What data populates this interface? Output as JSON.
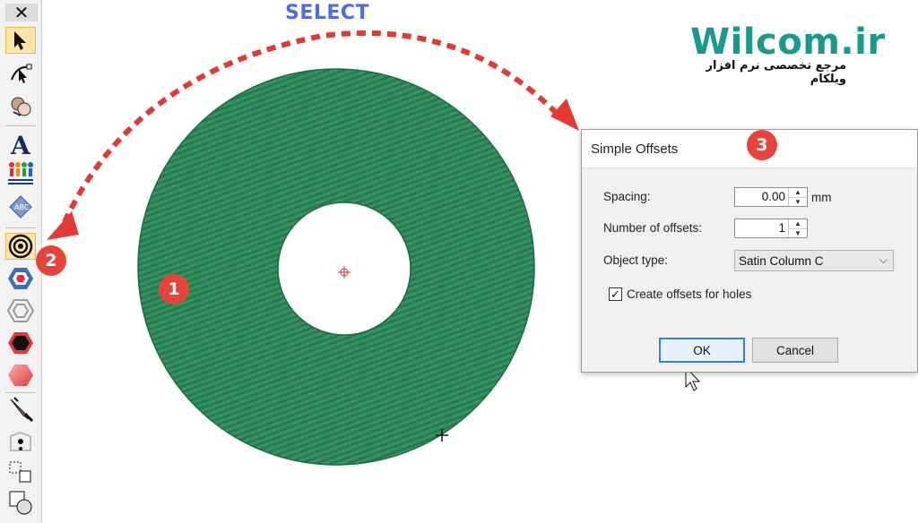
{
  "annotation": {
    "select_label": "SELECT",
    "brand_name": "Wilcom.ir",
    "brand_tagline": "مرجع تخصصی نرم افزار ویلکام",
    "callouts": [
      "1",
      "2",
      "3"
    ]
  },
  "toolbar": {
    "close_glyph": "✕",
    "tools": [
      {
        "name": "select-object-icon",
        "active": true
      },
      {
        "name": "reshape-object-icon",
        "active": false
      },
      {
        "name": "stitch-select-icon",
        "active": false
      },
      {
        "name": "lettering-icon",
        "active": false
      },
      {
        "name": "team-names-icon",
        "active": false
      },
      {
        "name": "monogram-icon",
        "active": false
      },
      {
        "name": "simple-offsets-icon",
        "active": true
      },
      {
        "name": "outlines-offsets-icon",
        "active": false
      },
      {
        "name": "offset-outline-icon",
        "active": false
      },
      {
        "name": "remove-overlaps-icon",
        "active": false
      },
      {
        "name": "fill-holes-icon",
        "active": false
      },
      {
        "name": "knife-icon",
        "active": false
      },
      {
        "name": "branching-icon",
        "active": false
      },
      {
        "name": "break-apart-icon",
        "active": false
      },
      {
        "name": "combine-icon",
        "active": false
      }
    ]
  },
  "canvas": {
    "object_fill_color": "#2e8a58",
    "arrow_color": "#e03a33"
  },
  "dialog": {
    "title": "Simple Offsets",
    "spacing_label": "Spacing:",
    "spacing_value": "0.00",
    "spacing_unit": "mm",
    "offsets_label": "Number of offsets:",
    "offsets_value": "1",
    "object_type_label": "Object type:",
    "object_type_value": "Satin Column C",
    "create_holes_label": "Create offsets for holes",
    "create_holes_checked": true,
    "ok_label": "OK",
    "cancel_label": "Cancel"
  }
}
